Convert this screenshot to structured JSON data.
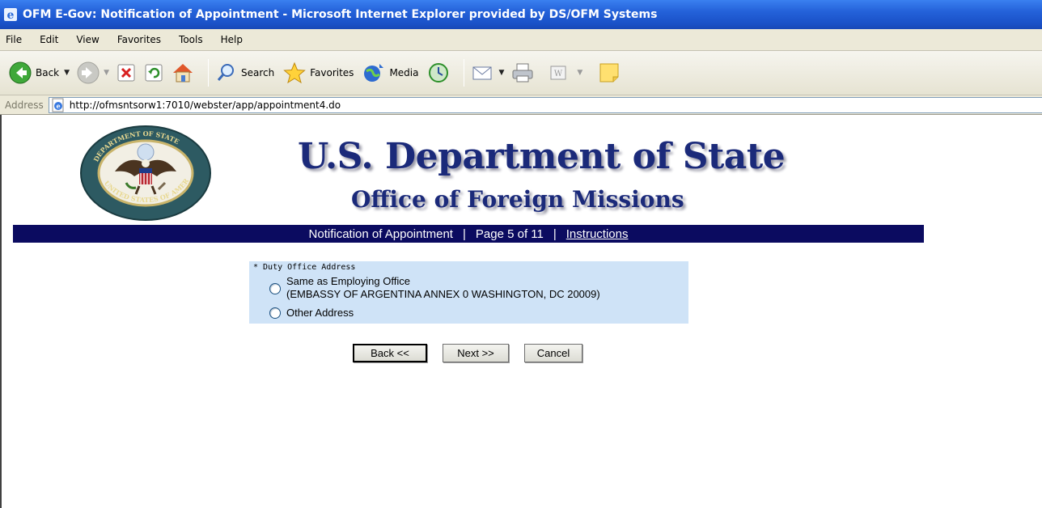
{
  "window": {
    "title": "OFM E-Gov: Notification of Appointment - Microsoft Internet Explorer provided by DS/OFM Systems"
  },
  "menu": [
    "File",
    "Edit",
    "View",
    "Favorites",
    "Tools",
    "Help"
  ],
  "toolbar": {
    "back_label": "Back",
    "search_label": "Search",
    "favorites_label": "Favorites",
    "media_label": "Media"
  },
  "address": {
    "label": "Address",
    "url": "http://ofmsntsorw1:7010/webster/app/appointment4.do"
  },
  "header": {
    "title": "U.S. Department of State",
    "subtitle": "Office of Foreign Missions",
    "seal_text": "DEPARTMENT OF STATE · UNITED STATES OF AMERICA"
  },
  "nav": {
    "section": "Notification of Appointment",
    "separator": "|",
    "page": "Page 5 of 11",
    "instructions": "Instructions"
  },
  "form": {
    "legend": "* Duty Office Address",
    "options": [
      {
        "label": "Same as Employing Office",
        "detail": "(EMBASSY OF ARGENTINA ANNEX 0 WASHINGTON, DC 20009)",
        "selected": false
      },
      {
        "label": "Other Address",
        "detail": "",
        "selected": false
      }
    ]
  },
  "buttons": {
    "back": "Back <<",
    "next": "Next >>",
    "cancel": "Cancel"
  },
  "colors": {
    "title_blue": "#1b2a7a",
    "nav_bar": "#0b0b60",
    "form_panel": "#cfe3f7"
  }
}
